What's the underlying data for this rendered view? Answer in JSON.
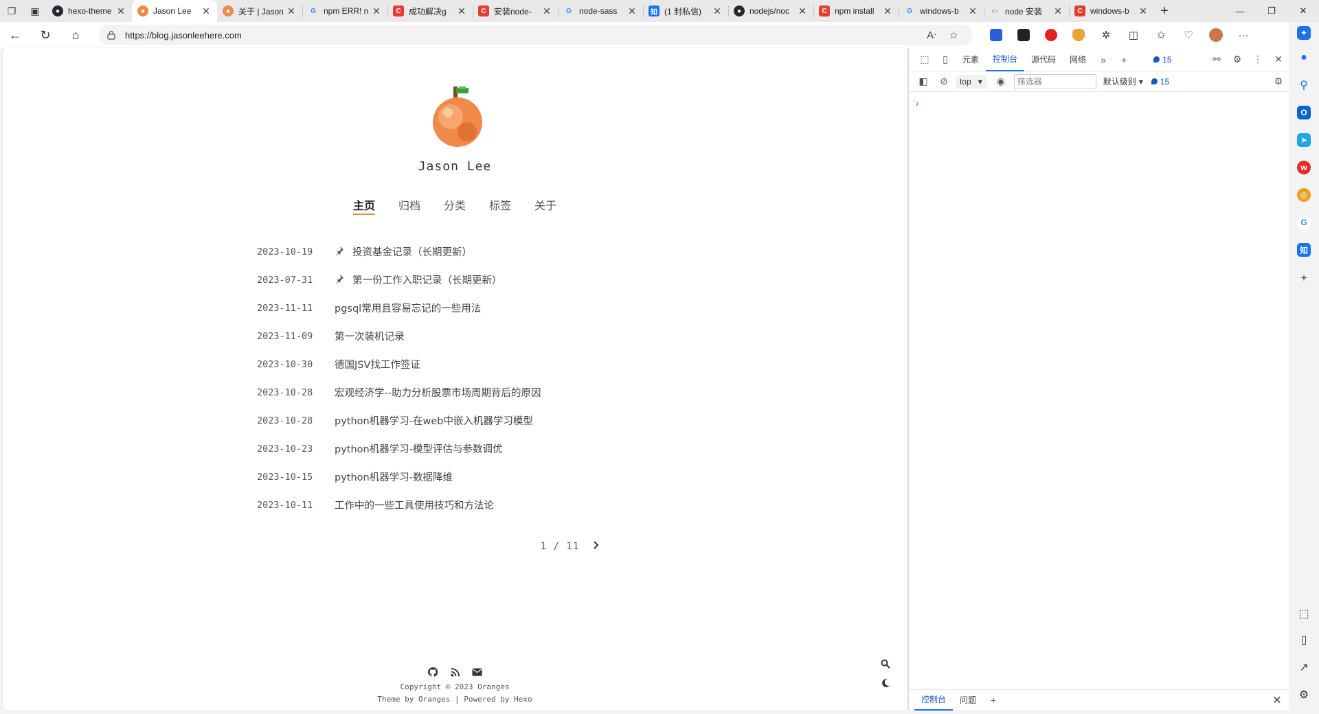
{
  "browser": {
    "tabs": [
      {
        "title": "hexo-theme",
        "icon": "github-icon",
        "color": "#24292f",
        "active": false
      },
      {
        "title": "Jason Lee",
        "icon": "orange-favicon-icon",
        "color": "#f08a4b",
        "active": true
      },
      {
        "title": "关于 | Jason",
        "icon": "orange-favicon-icon",
        "color": "#f08a4b",
        "active": false
      },
      {
        "title": "npm ERR! n",
        "icon": "google-icon",
        "color": "#4285f4",
        "active": false
      },
      {
        "title": "成功解决g",
        "icon": "csdn-icon",
        "color": "#e33e33",
        "active": false
      },
      {
        "title": "安装node-",
        "icon": "csdn-icon",
        "color": "#e33e33",
        "active": false
      },
      {
        "title": "node-sass",
        "icon": "google-icon",
        "color": "#4285f4",
        "active": false
      },
      {
        "title": "(1 封私信)",
        "icon": "zhihu-icon",
        "color": "#1772f6",
        "active": false
      },
      {
        "title": "nodejs/noc",
        "icon": "github-icon",
        "color": "#24292f",
        "active": false
      },
      {
        "title": "npm install",
        "icon": "csdn-icon",
        "color": "#e33e33",
        "active": false
      },
      {
        "title": "windows-b",
        "icon": "google-icon",
        "color": "#4285f4",
        "active": false
      },
      {
        "title": "node 安装",
        "icon": "document-icon",
        "color": "#777777",
        "active": false
      },
      {
        "title": "windows-b",
        "icon": "csdn-icon",
        "color": "#e33e33",
        "active": false
      }
    ],
    "url": "https://blog.jasonleehere.com"
  },
  "site": {
    "name": "Jason Lee",
    "menu": [
      "主页",
      "归档",
      "分类",
      "标签",
      "关于"
    ],
    "active_menu": 0
  },
  "posts": [
    {
      "date": "2023-10-19",
      "title": "投资基金记录（长期更新）",
      "pinned": true
    },
    {
      "date": "2023-07-31",
      "title": "第一份工作入职记录（长期更新）",
      "pinned": true
    },
    {
      "date": "2023-11-11",
      "title": "pgsql常用且容易忘记的一些用法",
      "pinned": false
    },
    {
      "date": "2023-11-09",
      "title": "第一次装机记录",
      "pinned": false
    },
    {
      "date": "2023-10-30",
      "title": "德国JSV找工作签证",
      "pinned": false
    },
    {
      "date": "2023-10-28",
      "title": "宏观经济学--助力分析股票市场周期背后的原因",
      "pinned": false
    },
    {
      "date": "2023-10-28",
      "title": "python机器学习-在web中嵌入机器学习模型",
      "pinned": false
    },
    {
      "date": "2023-10-23",
      "title": "python机器学习-模型评估与参数调优",
      "pinned": false
    },
    {
      "date": "2023-10-15",
      "title": "python机器学习-数据降维",
      "pinned": false
    },
    {
      "date": "2023-10-11",
      "title": "工作中的一些工具使用技巧和方法论",
      "pinned": false
    }
  ],
  "pagination": {
    "label": "1 / 11"
  },
  "footer": {
    "copyright": "Copyright © 2023 Oranges",
    "theme_prefix": "Theme by",
    "theme_link": "Oranges",
    "powered_prefix": "Powered by",
    "powered_link": "Hexo"
  },
  "devtools": {
    "tabs": [
      "元素",
      "控制台",
      "源代码",
      "网络"
    ],
    "active_tab": 1,
    "issue_count": "15",
    "context": "top",
    "filter_placeholder": "筛选器",
    "level": "默认级别",
    "message_count": "15",
    "drawer_tabs": [
      "控制台",
      "问题"
    ]
  },
  "colors": {
    "accent": "#f08a4b",
    "devtools_blue": "#1a73e8"
  }
}
